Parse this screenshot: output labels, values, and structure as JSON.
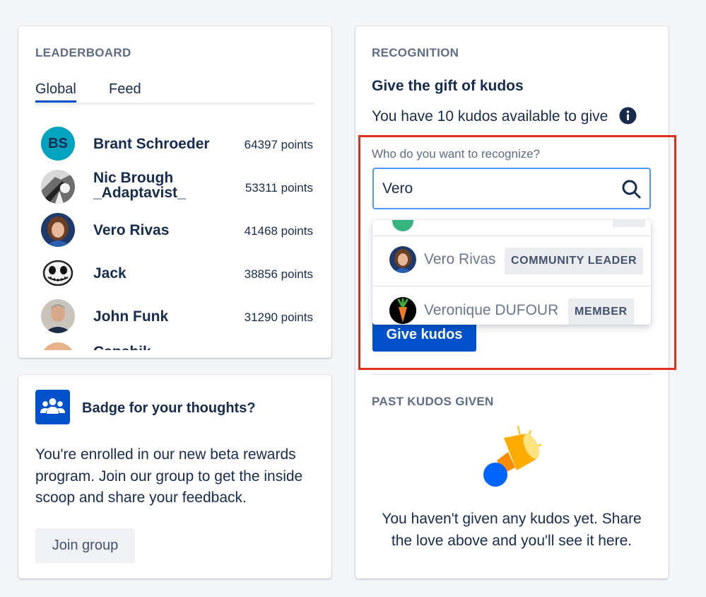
{
  "leaderboard": {
    "title": "LEADERBOARD",
    "tabs": [
      {
        "label": "Global",
        "active": true
      },
      {
        "label": "Feed",
        "active": false
      }
    ],
    "users": [
      {
        "initials": "BS",
        "name": "Brant Schroeder",
        "points": "64397 points"
      },
      {
        "name_line1": "Nic Brough",
        "name_line2": "_Adaptavist_",
        "points": "53311 points"
      },
      {
        "name": "Vero Rivas",
        "points": "41468 points"
      },
      {
        "name": "Jack",
        "points": "38856 points"
      },
      {
        "name": "John Funk",
        "points": "31290 points"
      },
      {
        "name": "Capebik",
        "points": ""
      }
    ]
  },
  "badge_card": {
    "title": "Badge for your thoughts?",
    "body": "You're enrolled in our new beta rewards program. Join our group to get the inside scoop and share your feedback.",
    "button": "Join group"
  },
  "recognition": {
    "title": "RECOGNITION",
    "heading": "Give the gift of kudos",
    "available": "You have 10 kudos available to give",
    "field_label": "Who do you want to recognize?",
    "search_value": "Vero",
    "suggestions": [
      {
        "name": "Vero Rivas",
        "badge": "COMMUNITY LEADER"
      },
      {
        "name": "Veronique DUFOUR",
        "badge": "MEMBER"
      }
    ],
    "give_button": "Give kudos"
  },
  "past_kudos": {
    "title": "PAST KUDOS GIVEN",
    "empty_message": "You haven't given any kudos yet. Share the love above and you'll see it here."
  },
  "colors": {
    "accent": "#0052cc",
    "focus": "#4c9aff",
    "highlight": "#e0301e"
  }
}
